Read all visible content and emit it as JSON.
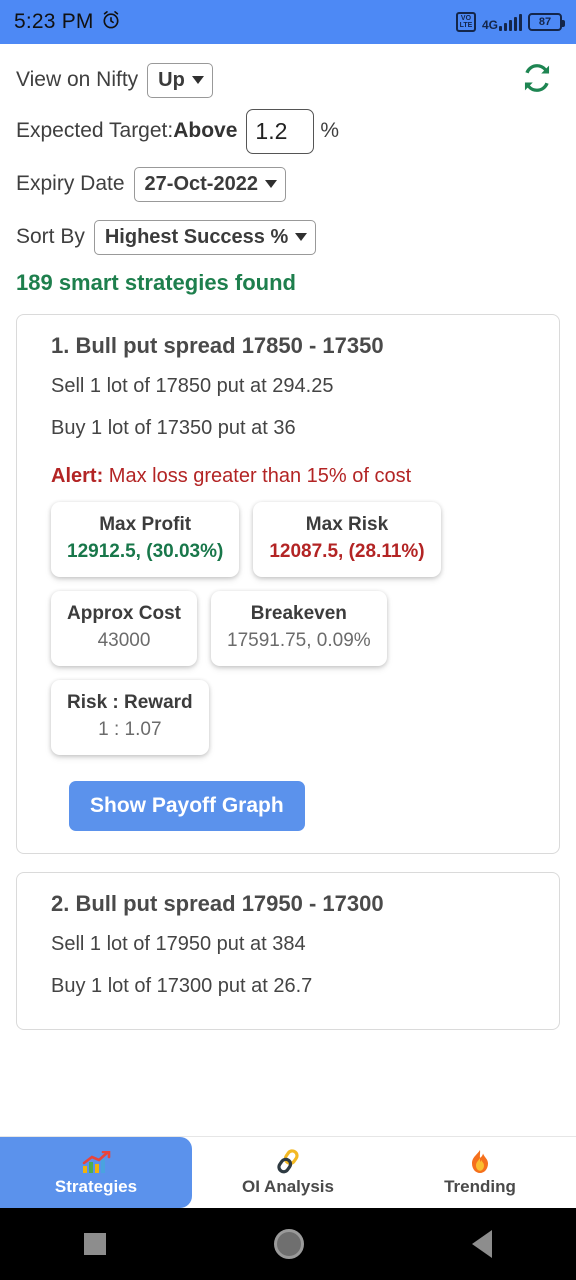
{
  "statusbar": {
    "time": "5:23 PM",
    "alarm_icon": "alarm-clock-icon",
    "volte_top": "VO",
    "volte_bottom": "LTE",
    "network": "4G",
    "battery_level": "87"
  },
  "filters": {
    "view_label": "View on Nifty",
    "view_value": "Up",
    "target_label": "Expected Target: ",
    "target_label_bold": "Above",
    "target_value": "1.2",
    "percent_symbol": "%",
    "expiry_label": "Expiry Date",
    "expiry_value": "27-Oct-2022",
    "sort_label": "Sort By",
    "sort_value": "Highest Success %",
    "refresh_icon": "refresh-icon"
  },
  "results_count_text": "189 smart strategies found",
  "colors": {
    "accent_blue": "#5b92ec",
    "statusbar_blue": "#4d89f5",
    "success_green": "#18774a",
    "danger_red": "#b32424",
    "found_green": "#1e7f4d"
  },
  "strategies": [
    {
      "title": "1. Bull put spread 17850 - 17350",
      "leg1": "Sell 1 lot of 17850 put at 294.25",
      "leg2": "Buy 1 lot of 17350 put at 36",
      "alert_prefix": "Alert:",
      "alert_text": " Max loss greater than 15% of cost",
      "metrics": [
        {
          "label": "Max Profit",
          "value": "12912.5, (30.03%)"
        },
        {
          "label": "Max Risk",
          "value": "12087.5, (28.11%)"
        },
        {
          "label": "Approx Cost",
          "value": "43000"
        },
        {
          "label": "Breakeven",
          "value": "17591.75, 0.09%"
        },
        {
          "label": "Risk : Reward",
          "value": "1 : 1.07"
        }
      ],
      "payoff_button": "Show Payoff Graph"
    },
    {
      "title": "2. Bull put spread 17950 - 17300",
      "leg1": "Sell 1 lot of 17950 put at 384",
      "leg2": "Buy 1 lot of 17300 put at 26.7"
    }
  ],
  "bottom_nav": [
    {
      "label": "Strategies",
      "icon": "bar-chart-icon"
    },
    {
      "label": "OI Analysis",
      "icon": "chain-link-icon"
    },
    {
      "label": "Trending",
      "icon": "fire-icon"
    }
  ],
  "system_nav": [
    {
      "name": "recents-button",
      "icon": "square-icon"
    },
    {
      "name": "home-button",
      "icon": "circle-icon"
    },
    {
      "name": "back-button",
      "icon": "triangle-left-icon"
    }
  ]
}
